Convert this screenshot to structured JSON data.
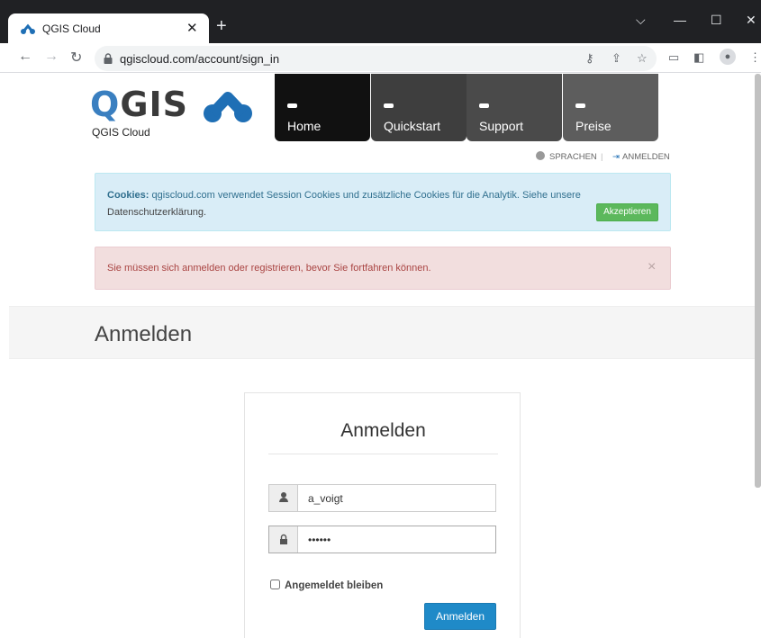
{
  "browser": {
    "tab_title": "QGIS Cloud",
    "tab_close": "✕",
    "new_tab": "+",
    "url": "qgiscloud.com/account/sign_in",
    "window_controls": {
      "chevron": "⌵",
      "minimize": "—",
      "maximize": "☐",
      "close": "✕"
    },
    "nav": {
      "back": "←",
      "forward": "→",
      "reload": "↻"
    }
  },
  "header": {
    "logo_q": "Q",
    "logo_gis": "GIS",
    "logo_subtitle": "QGIS Cloud",
    "nav_items": [
      "Home",
      "Quickstart",
      "Support",
      "Preise"
    ],
    "lang_label": "SPRACHEN",
    "separator": "|",
    "signin_label": "ANMELDEN"
  },
  "cookie_notice": {
    "bold": "Cookies:",
    "text": " qgiscloud.com verwendet Session Cookies und zusätzliche Cookies für die Analytik. Siehe unsere",
    "privacy_link": "Datenschutzerklärung",
    "period": ".",
    "accept": "Akzeptieren"
  },
  "alert": {
    "text": "Sie müssen sich anmelden oder registrieren, bevor Sie fortfahren können.",
    "close": "×"
  },
  "page_title": "Anmelden",
  "login_form": {
    "title": "Anmelden",
    "username_value": "a_voigt",
    "password_value": "••••••",
    "remember_label": "Angemeldet bleiben",
    "submit": "Anmelden"
  },
  "colors": {
    "brand_blue": "#3a7fc0",
    "submit_blue": "#1f8ac8",
    "accept_green": "#5cb85c",
    "alert_red": "#a94442",
    "info_blue": "#31708f"
  }
}
